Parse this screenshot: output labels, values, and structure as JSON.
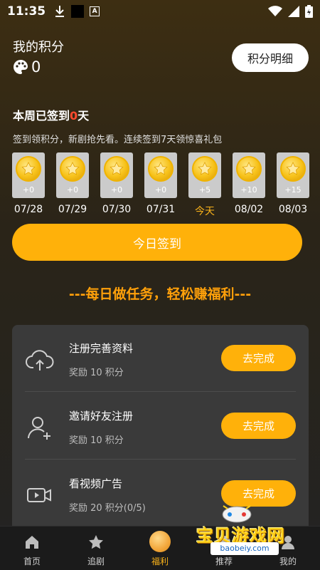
{
  "status_bar": {
    "time": "11:35",
    "badge": "A"
  },
  "points": {
    "label": "我的积分",
    "value": "0",
    "detail_button": "积分明细"
  },
  "week": {
    "title_prefix": "本周已签到",
    "days_count": "0",
    "title_suffix": "天",
    "description": "签到领积分，新剧抢先看。连续签到7天领惊喜礼包"
  },
  "days": [
    {
      "points": "+0",
      "date": "07/28"
    },
    {
      "points": "+0",
      "date": "07/29"
    },
    {
      "points": "+0",
      "date": "07/30"
    },
    {
      "points": "+0",
      "date": "07/31"
    },
    {
      "points": "+5",
      "date": "今天"
    },
    {
      "points": "+10",
      "date": "08/02"
    },
    {
      "points": "+15",
      "date": "08/03"
    }
  ],
  "checkin_button": "今日签到",
  "tasks_heading": "---每日做任务，轻松赚福利---",
  "tasks": [
    {
      "name": "注册完善资料",
      "reward": "奖励 10 积分",
      "button": "去完成",
      "icon": "cloud-upload-icon"
    },
    {
      "name": "邀请好友注册",
      "reward": "奖励 10 积分",
      "button": "去完成",
      "icon": "add-user-icon"
    },
    {
      "name": "看视频广告",
      "reward": "奖励 20 积分(0/5)",
      "button": "去完成",
      "icon": "video-icon"
    }
  ],
  "nav": [
    {
      "label": "首页",
      "icon": "home-icon"
    },
    {
      "label": "追剧",
      "icon": "star-icon"
    },
    {
      "label": "福利",
      "icon": "coin-icon"
    },
    {
      "label": "推荐",
      "icon": "recommend-icon"
    },
    {
      "label": "我的",
      "icon": "profile-icon"
    }
  ],
  "watermark": {
    "text": "宝贝游戏网",
    "url": "baobeiy.com"
  },
  "colors": {
    "accent": "#ffb10a",
    "today": "#f7b11a",
    "highlight": "#ff4a2e",
    "heading": "#ffa00a"
  }
}
